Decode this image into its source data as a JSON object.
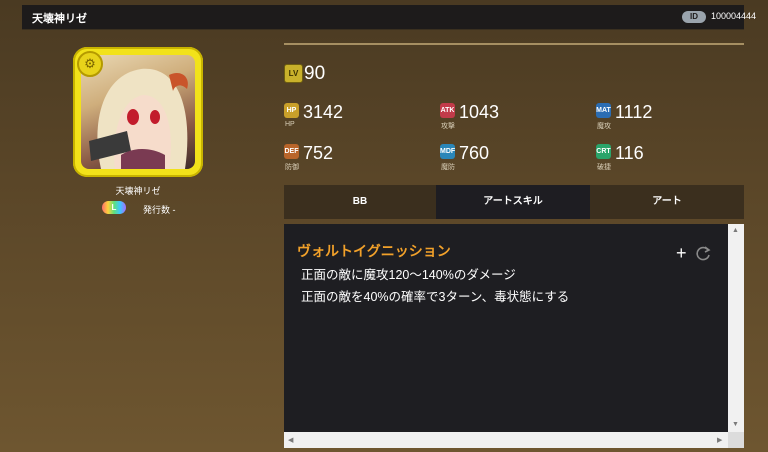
{
  "header": {
    "title": "天壊神リゼ",
    "id_label": "ID",
    "id_value": "100004444"
  },
  "unit": {
    "name": "天壊神リゼ",
    "element_badge": "L",
    "issue_label": "発行数 -"
  },
  "stats": {
    "level": {
      "icon": "LV",
      "value": "90"
    },
    "hp": {
      "icon": "HP",
      "label": "HP",
      "value": "3142",
      "color": "#c9a02a"
    },
    "atk": {
      "icon": "ATK",
      "label": "攻撃",
      "value": "1043",
      "color": "#c23b4a"
    },
    "matk": {
      "icon": "MAT",
      "label": "魔攻",
      "value": "1112",
      "color": "#2b6db3"
    },
    "def": {
      "icon": "DEF",
      "label": "防御",
      "value": "752",
      "color": "#b9652a"
    },
    "mdef": {
      "icon": "MDF",
      "label": "魔防",
      "value": "760",
      "color": "#2a86b8"
    },
    "crit": {
      "icon": "CRT",
      "label": "破捷",
      "value": "116",
      "color": "#2aa46a"
    }
  },
  "tabs": [
    {
      "label": "BB",
      "active": false
    },
    {
      "label": "アートスキル",
      "active": true
    },
    {
      "label": "アート",
      "active": false
    }
  ],
  "skill": {
    "name": "ヴォルトイグニッション",
    "lines": [
      "正面の敵に魔攻120～140%のダメージ",
      "正面の敵を40%の確率で3ターン、毒状態にする"
    ]
  },
  "icons": [
    "rarity-icon",
    "plus-icon",
    "refresh-icon",
    "scroll-up-icon",
    "scroll-down-icon",
    "scroll-left-icon",
    "scroll-right-icon"
  ],
  "colors": {
    "accent": "#f2a12a",
    "panel": "#1e1e22",
    "frame": "#f2e21a"
  }
}
